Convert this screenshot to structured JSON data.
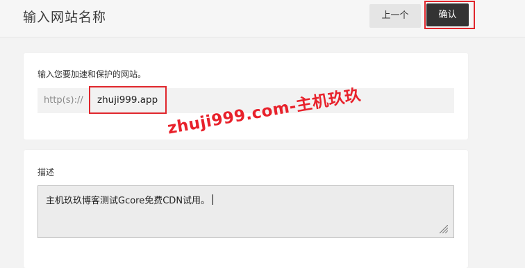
{
  "header": {
    "title": "输入网站名称",
    "prev_label": "上一个",
    "confirm_label": "确认"
  },
  "domain_card": {
    "label": "输入您要加速和保护的网站。",
    "prefix": "http(s)://",
    "value": "zhuji999.app"
  },
  "desc_card": {
    "label": "描述",
    "value": "主机玖玖博客测试Gcore免费CDN试用。"
  },
  "watermark": "zhuji999.com-主机玖玖",
  "colors": {
    "highlight": "#e0262c",
    "confirm_bg": "#333333",
    "watermark": "#e8212b"
  }
}
